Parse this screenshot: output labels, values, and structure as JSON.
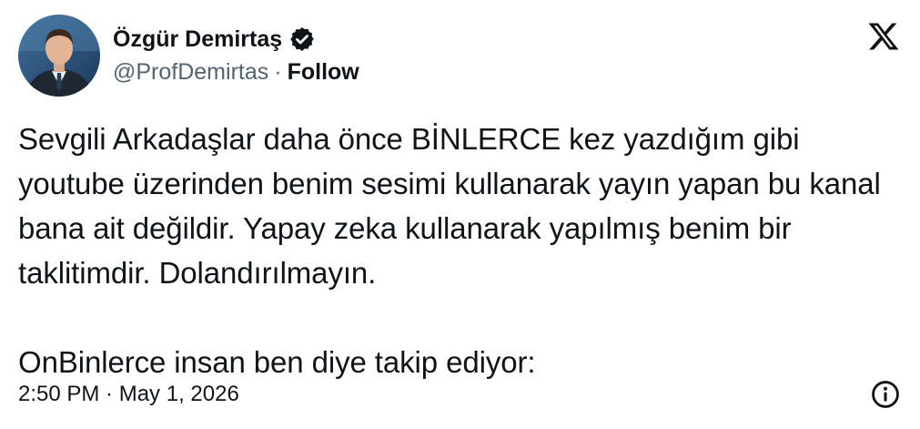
{
  "author": {
    "name": "Özgür Demirtaş",
    "handle": "@ProfDemirtas",
    "separator": "·",
    "follow_label": "Follow",
    "avatar_icon": "profile-photo",
    "verified_icon": "verified-badge-icon"
  },
  "brand": {
    "logo_icon": "x-logo-icon"
  },
  "tweet": {
    "paragraph_1": "Sevgili Arkadaşlar daha önce BİNLERCE kez yazdığım gibi youtube üzerinden benim sesimi kullanarak yayın yapan bu kanal bana ait değildir. Yapay zeka kullanarak yapılmış benim bir taklitimdir. Dolandırılmayın.",
    "paragraph_2": "OnBinlerce insan ben diye takip ediyor:"
  },
  "footer": {
    "timestamp": "2:50 PM · May 1, 2026",
    "info_icon": "info-icon"
  },
  "colors": {
    "text": "#0f1419",
    "secondary": "#536471",
    "background": "#ffffff"
  }
}
